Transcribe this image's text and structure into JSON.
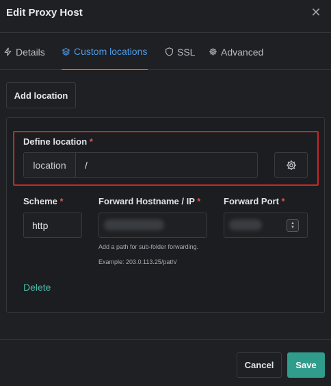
{
  "modal": {
    "title": "Edit Proxy Host",
    "close_icon": "close-icon"
  },
  "tabs": [
    {
      "label": "Details",
      "icon": "bolt-icon",
      "active": false
    },
    {
      "label": "Custom locations",
      "icon": "layers-icon",
      "active": true
    },
    {
      "label": "SSL",
      "icon": "shield-icon",
      "active": false
    },
    {
      "label": "Advanced",
      "icon": "gear-icon",
      "active": false
    }
  ],
  "add_location_label": "Add location",
  "location": {
    "define_label": "Define location",
    "required_mark": "*",
    "prefix": "location",
    "path_value": "/",
    "settings_icon": "gear-icon",
    "scheme_label": "Scheme",
    "scheme_value": "http",
    "host_label": "Forward Hostname / IP",
    "port_label": "Forward Port",
    "hint_1": "Add a path for sub-folder forwarding.",
    "hint_2": "Example: 203.0.113.25/path/",
    "delete_label": "Delete"
  },
  "footer": {
    "cancel_label": "Cancel",
    "save_label": "Save"
  },
  "colors": {
    "accent": "#4d9be6",
    "save": "#2f9c8c",
    "required": "#e05252",
    "highlight_border": "#c62828",
    "delete_link": "#4ab8a6"
  }
}
